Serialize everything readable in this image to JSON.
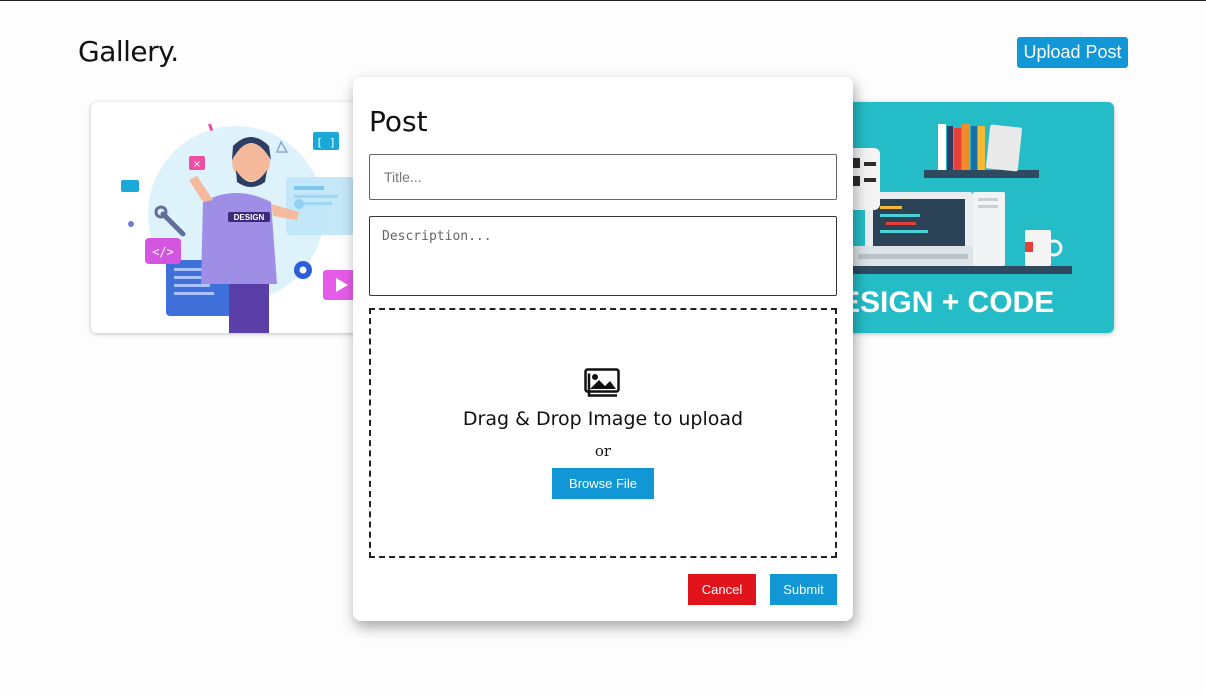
{
  "header": {
    "site_title": "Gallery.",
    "upload_button_label": "Upload Post"
  },
  "gallery": {
    "cards": [
      {
        "illustration": "designer-illustration",
        "badge_text": "DESIGN"
      },
      {
        "illustration": "design-code-illustration",
        "banner_text": "ESIGN + CODE"
      }
    ]
  },
  "modal": {
    "title": "Post",
    "title_placeholder": "Title...",
    "description_placeholder": "Description...",
    "dropzone": {
      "icon": "images-icon",
      "text": "Drag & Drop Image to upload",
      "or_text": "or",
      "browse_label": "Browse File"
    },
    "cancel_label": "Cancel",
    "submit_label": "Submit"
  },
  "colors": {
    "accent": "#1196d6",
    "danger": "#e0141a",
    "teal_card": "#24bcc6"
  }
}
